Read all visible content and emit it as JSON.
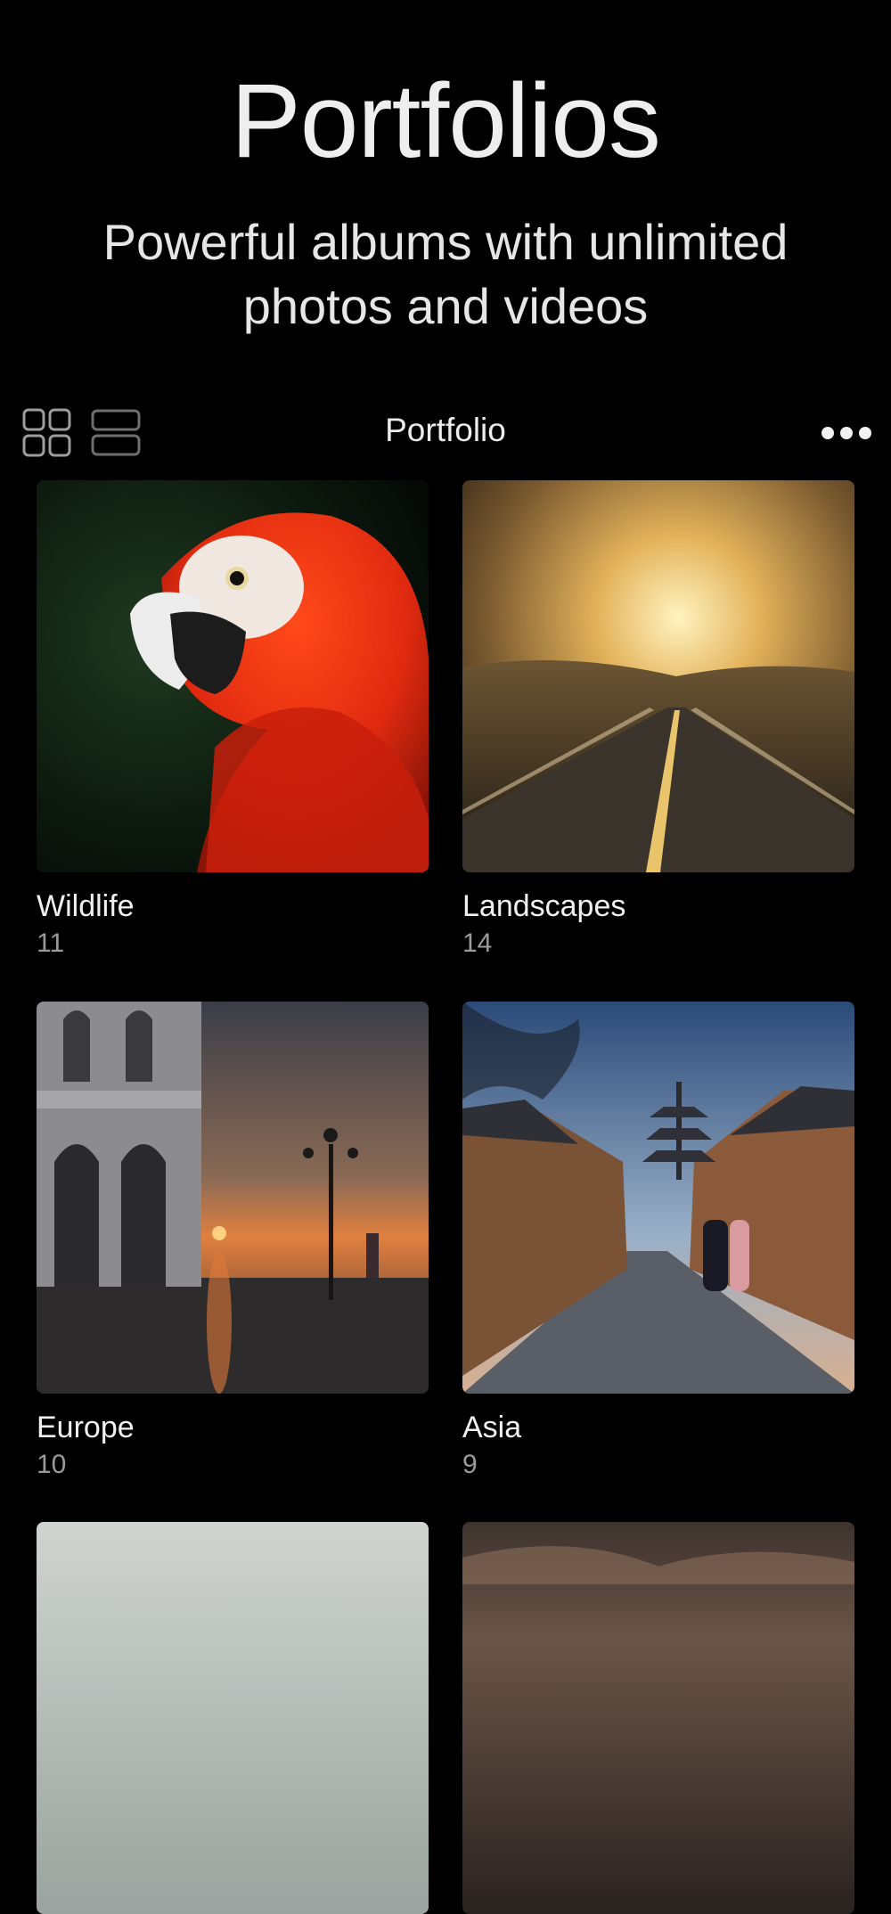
{
  "hero": {
    "title": "Portfolios",
    "subtitle": "Powerful albums with unlimited photos and videos"
  },
  "toolbar": {
    "title": "Portfolio",
    "grid_view_icon": "grid-view-icon",
    "list_view_icon": "list-view-icon",
    "more_icon": "more-icon"
  },
  "albums": [
    {
      "name": "Wildlife",
      "count": "11",
      "thumbnail": "red macaw parrot"
    },
    {
      "name": "Landscapes",
      "count": "14",
      "thumbnail": "golden road sunset"
    },
    {
      "name": "Europe",
      "count": "10",
      "thumbnail": "venice sunset lamppost"
    },
    {
      "name": "Asia",
      "count": "9",
      "thumbnail": "kyoto pagoda street"
    },
    {
      "name": "",
      "count": "",
      "thumbnail": "cloudy sky"
    },
    {
      "name": "",
      "count": "",
      "thumbnail": "dusk clouds"
    }
  ],
  "colors": {
    "background": "#000000",
    "text_primary": "#efefef",
    "text_secondary": "#9a9a9a"
  }
}
